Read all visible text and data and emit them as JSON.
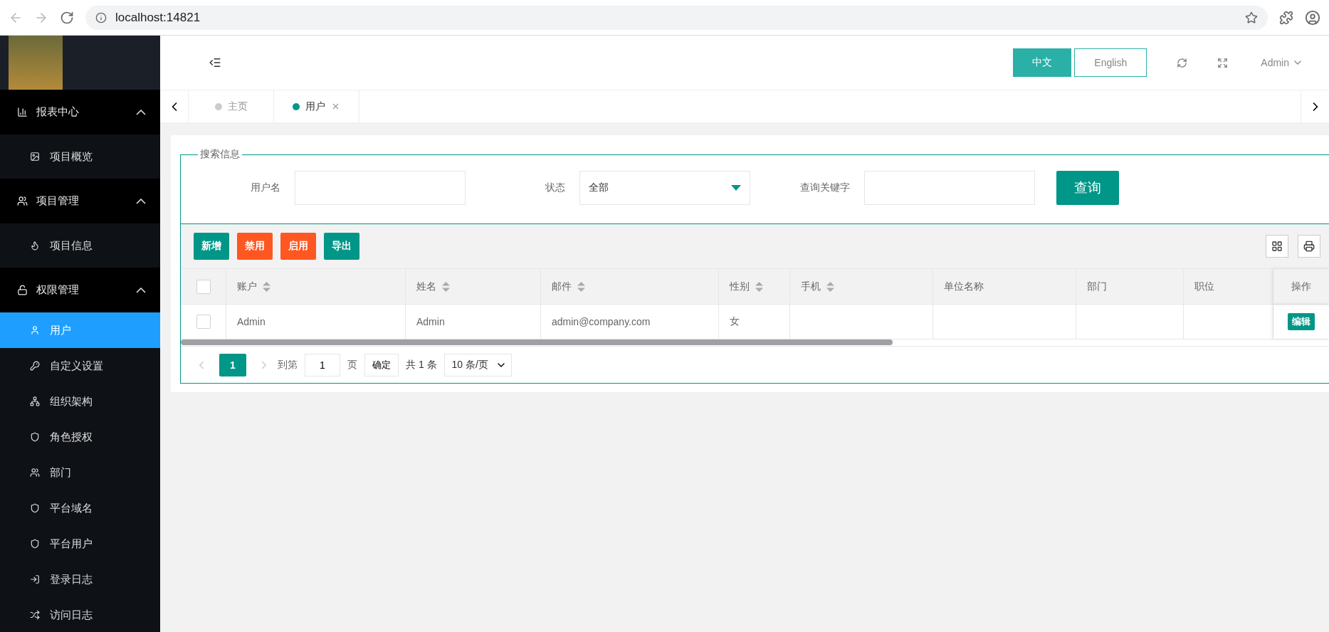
{
  "browser": {
    "url": "localhost:14821"
  },
  "sidebar": {
    "groups": [
      {
        "label": "报表中心",
        "expanded": true,
        "children": [
          {
            "label": "项目概览",
            "selected": false
          }
        ]
      },
      {
        "label": "项目管理",
        "expanded": true,
        "children": [
          {
            "label": "项目信息",
            "selected": false
          }
        ]
      },
      {
        "label": "权限管理",
        "expanded": true,
        "children": [
          {
            "label": "用户",
            "selected": true
          },
          {
            "label": "自定义设置",
            "selected": false
          },
          {
            "label": "组织架构",
            "selected": false
          },
          {
            "label": "角色授权",
            "selected": false
          },
          {
            "label": "部门",
            "selected": false
          },
          {
            "label": "平台域名",
            "selected": false
          },
          {
            "label": "平台用户",
            "selected": false
          },
          {
            "label": "登录日志",
            "selected": false
          },
          {
            "label": "访问日志",
            "selected": false
          }
        ]
      }
    ]
  },
  "header": {
    "languages": [
      {
        "label": "中文",
        "selected": true
      },
      {
        "label": "English",
        "selected": false
      }
    ],
    "user": "Admin"
  },
  "tabs": [
    {
      "label": "主页",
      "selected": false,
      "closable": false
    },
    {
      "label": "用户",
      "selected": true,
      "closable": true
    }
  ],
  "search": {
    "legend": "搜索信息",
    "fields": [
      {
        "kind": "text",
        "label": "用户名"
      },
      {
        "kind": "select",
        "label": "状态",
        "value": "全部"
      },
      {
        "kind": "text",
        "label": "查询关键字"
      }
    ],
    "button": "查询"
  },
  "toolbar": [
    {
      "label": "新增",
      "kind": "primary"
    },
    {
      "label": "禁用",
      "kind": "danger"
    },
    {
      "label": "启用",
      "kind": "danger"
    },
    {
      "label": "导出",
      "kind": "primary"
    }
  ],
  "table": {
    "header_checked": false,
    "columns": [
      {
        "label": "账户",
        "sortable": true
      },
      {
        "label": "姓名",
        "sortable": true
      },
      {
        "label": "邮件",
        "sortable": true
      },
      {
        "label": "性别",
        "sortable": true
      },
      {
        "label": "手机",
        "sortable": true
      },
      {
        "label": "单位名称",
        "sortable": false
      },
      {
        "label": "部门",
        "sortable": false
      },
      {
        "label": "职位",
        "sortable": false
      }
    ],
    "action_column": "操作",
    "rows": [
      {
        "checked": false,
        "cells": [
          "Admin",
          "Admin",
          "admin@company.com",
          "女",
          "",
          "",
          "",
          ""
        ],
        "action": "编辑"
      }
    ]
  },
  "pagination": {
    "current": "1",
    "goto": "到第",
    "page_input": "1",
    "page_unit": "页",
    "confirm": "确定",
    "total": "共 1 条",
    "page_size": "10 条/页"
  }
}
